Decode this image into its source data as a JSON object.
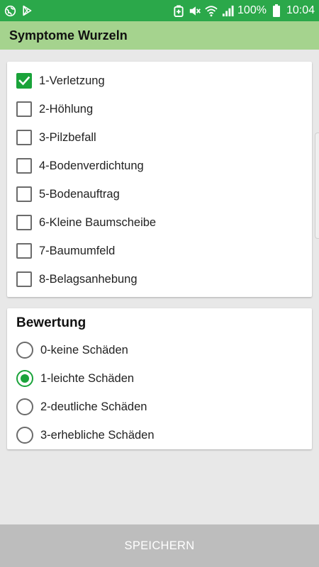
{
  "status_bar": {
    "battery_percent": "100%",
    "time": "10:04",
    "icons": [
      "globe-icon",
      "play-store-icon",
      "battery-saver-icon",
      "mute-icon",
      "wifi-icon",
      "signal-icon",
      "battery-icon"
    ]
  },
  "app_bar": {
    "title": "Symptome Wurzeln"
  },
  "symptoms": {
    "items": [
      {
        "label": "1-Verletzung",
        "checked": true
      },
      {
        "label": "2-Höhlung",
        "checked": false
      },
      {
        "label": "3-Pilzbefall",
        "checked": false
      },
      {
        "label": "4-Bodenverdichtung",
        "checked": false
      },
      {
        "label": "5-Bodenauftrag",
        "checked": false
      },
      {
        "label": "6-Kleine Baumscheibe",
        "checked": false
      },
      {
        "label": "7-Baumumfeld",
        "checked": false
      },
      {
        "label": "8-Belagsanhebung",
        "checked": false
      }
    ]
  },
  "rating": {
    "title": "Bewertung",
    "options": [
      {
        "label": "0-keine Schäden",
        "selected": false
      },
      {
        "label": "1-leichte Schäden",
        "selected": true
      },
      {
        "label": "2-deutliche Schäden",
        "selected": false
      },
      {
        "label": "3-erhebliche Schäden",
        "selected": false
      }
    ]
  },
  "save_button": {
    "label": "SPEICHERN"
  },
  "colors": {
    "status_bar": "#2ba84a",
    "app_bar": "#a5d38e",
    "accent": "#1aa33a",
    "save_bar": "#bdbdbd"
  }
}
